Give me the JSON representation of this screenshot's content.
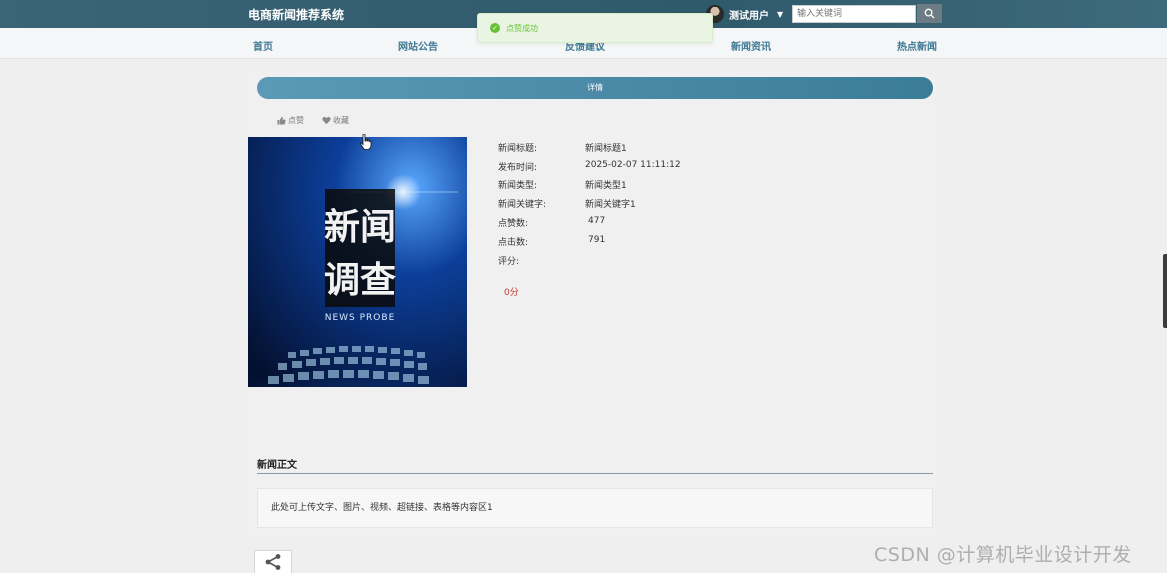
{
  "header": {
    "brand": "电商新闻推荐系统",
    "user_name": "测试用户",
    "search_placeholder": "输入关键词"
  },
  "nav": {
    "items": [
      "首页",
      "网站公告",
      "反馈建议",
      "新闻资讯",
      "热点新闻"
    ]
  },
  "toast": {
    "message": "点赞成功",
    "color": "#67c23a"
  },
  "detail": {
    "title_bar": "详情",
    "actions": {
      "like_label": "点赞",
      "favorite_label": "收藏"
    },
    "cover": {
      "line1": "新闻",
      "line2": "调查",
      "caption": "NEWS PROBE"
    },
    "fields": [
      {
        "label": "新闻标题:",
        "value": "新闻标题1"
      },
      {
        "label": "发布时间:",
        "value": "2025-02-07 11:11:12"
      },
      {
        "label": "新闻类型:",
        "value": "新闻类型1"
      },
      {
        "label": "新闻关键字:",
        "value": "新闻关键字1"
      },
      {
        "label": "点赞数:",
        "value": "477"
      },
      {
        "label": "点击数:",
        "value": "791"
      },
      {
        "label": "评分:",
        "value": ""
      }
    ],
    "score": "0分"
  },
  "body": {
    "section_title": "新闻正文",
    "content": "此处可上传文字、图片、视频、超链接、表格等内容区1"
  },
  "watermark": "CSDN @计算机毕业设计开发",
  "colors": {
    "accent": "#3d7a92",
    "topbar": "#2f5a6c",
    "score": "#c0392b"
  }
}
